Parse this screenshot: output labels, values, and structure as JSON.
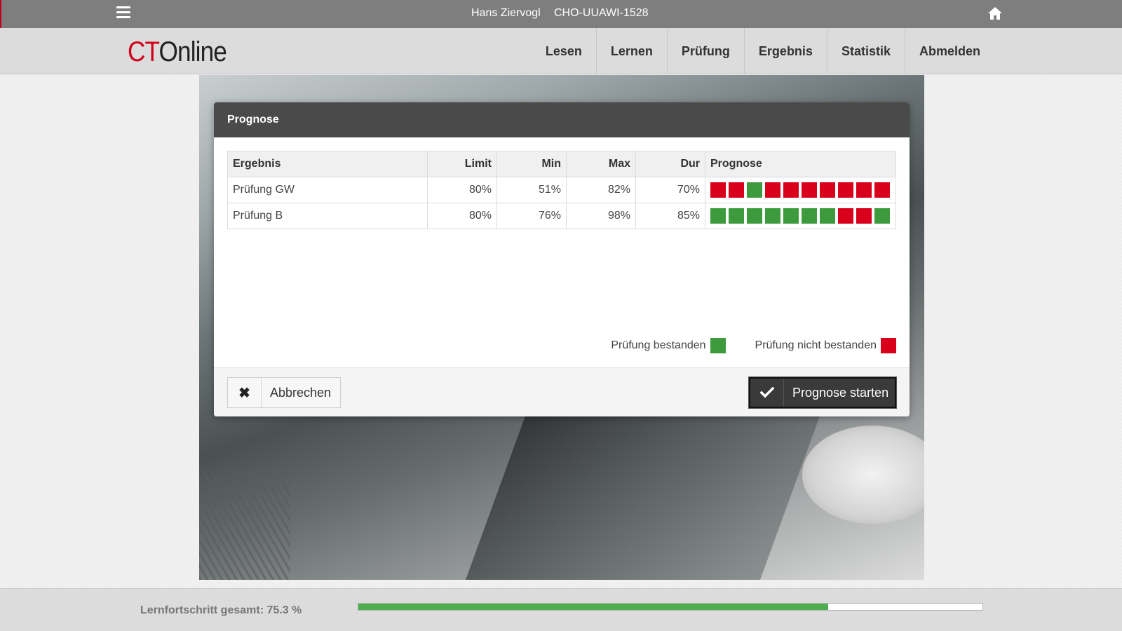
{
  "topbar": {
    "user_name": "Hans Ziervogl",
    "device_id": "CHO-UUAWI-1528"
  },
  "logo": {
    "part1": "CT",
    "part2": "Online"
  },
  "nav": {
    "items": [
      "Lesen",
      "Lernen",
      "Prüfung",
      "Ergebnis",
      "Statistik",
      "Abmelden"
    ]
  },
  "modal": {
    "title": "Prognose",
    "table": {
      "headers": [
        "Ergebnis",
        "Limit",
        "Min",
        "Max",
        "Dur",
        "Prognose"
      ],
      "rows": [
        {
          "name": "Prüfung GW",
          "limit": "80%",
          "min": "51%",
          "max": "82%",
          "dur": "70%",
          "prognose": [
            "fail",
            "fail",
            "pass",
            "fail",
            "fail",
            "fail",
            "fail",
            "fail",
            "fail",
            "fail"
          ]
        },
        {
          "name": "Prüfung B",
          "limit": "80%",
          "min": "76%",
          "max": "98%",
          "dur": "85%",
          "prognose": [
            "pass",
            "pass",
            "pass",
            "pass",
            "pass",
            "pass",
            "pass",
            "fail",
            "fail",
            "pass"
          ]
        }
      ]
    },
    "legend": {
      "pass_label": "Prüfung bestanden",
      "fail_label": "Prüfung nicht bestanden"
    },
    "buttons": {
      "cancel": "Abbrechen",
      "start": "Prognose starten"
    }
  },
  "colors": {
    "pass": "#3d9b3d",
    "fail": "#d9001b",
    "brand": "#d0021b"
  },
  "footer": {
    "progress_label": "Lernfortschritt gesamt: 75.3 %",
    "progress_percent": 75.3
  }
}
